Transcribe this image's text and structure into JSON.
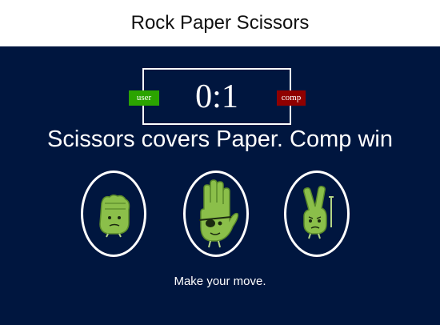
{
  "header": {
    "title": "Rock Paper Scissors"
  },
  "scoreboard": {
    "score": "0:1",
    "user_label": "user",
    "comp_label": "comp"
  },
  "result": {
    "message": "Scissors covers Paper. Comp win"
  },
  "choices": [
    {
      "name": "rock",
      "icon": "rock-hand-icon"
    },
    {
      "name": "paper",
      "icon": "paper-hand-icon"
    },
    {
      "name": "scissors",
      "icon": "scissors-hand-icon"
    }
  ],
  "prompt": {
    "text": "Make your move."
  },
  "colors": {
    "board_bg": "#00163f",
    "user_badge": "#2ba400",
    "comp_badge": "#8f0000",
    "hand_green": "#8bbf4a"
  }
}
